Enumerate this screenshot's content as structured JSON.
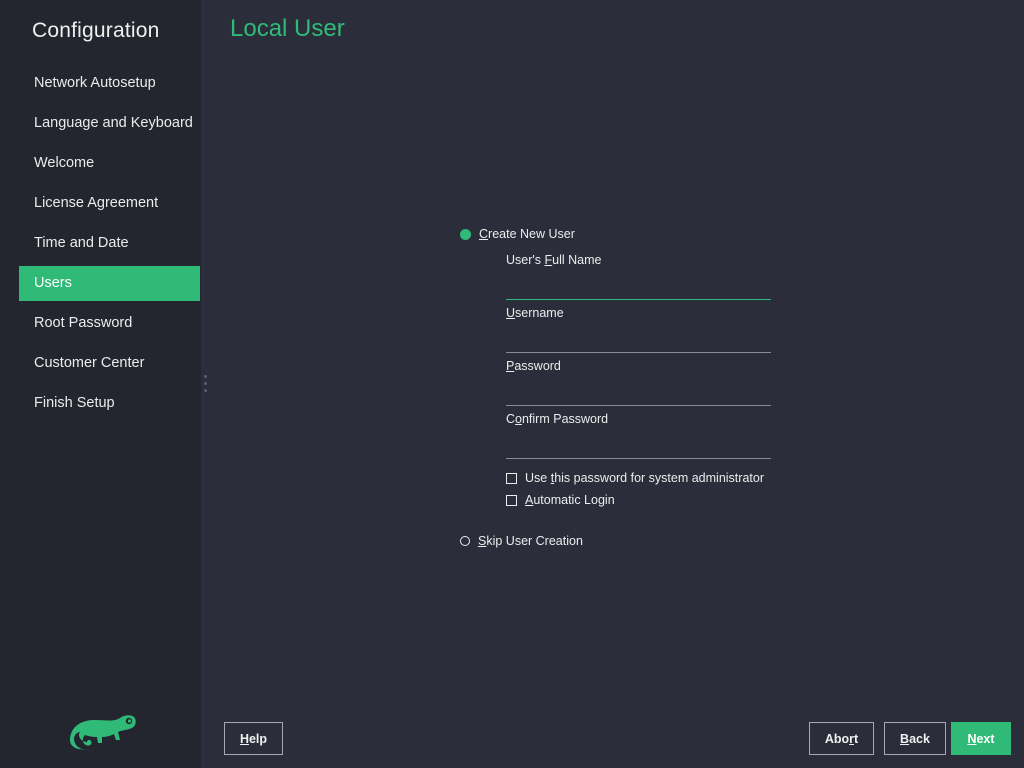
{
  "sidebar": {
    "title": "Configuration",
    "items": [
      {
        "label": "Network Autosetup"
      },
      {
        "label": "Language and Keyboard"
      },
      {
        "label": "Welcome"
      },
      {
        "label": "License Agreement"
      },
      {
        "label": "Time and Date"
      },
      {
        "label": "Users",
        "active": true
      },
      {
        "label": "Root Password"
      },
      {
        "label": "Customer Center"
      },
      {
        "label": "Finish Setup"
      }
    ]
  },
  "main": {
    "title": "Local User",
    "create_user": {
      "label_mnemonic": "C",
      "label_rest": "reate New User",
      "selected": true
    },
    "fields": {
      "full_name": {
        "pre": "User's ",
        "mnemonic": "F",
        "post": "ull Name",
        "value": ""
      },
      "username": {
        "pre": "",
        "mnemonic": "U",
        "post": "sername",
        "value": ""
      },
      "password": {
        "pre": "",
        "mnemonic": "P",
        "post": "assword",
        "value": ""
      },
      "confirm": {
        "pre": "C",
        "mnemonic": "o",
        "post": "nfirm Password",
        "value": ""
      }
    },
    "checkboxes": {
      "use_for_admin": {
        "pre": "Use ",
        "mnemonic": "t",
        "post": "his password for system administrator",
        "checked": false
      },
      "auto_login": {
        "pre": "",
        "mnemonic": "A",
        "post": "utomatic Login",
        "checked": false
      }
    },
    "skip_user": {
      "label_mnemonic": "S",
      "label_rest": "kip User Creation",
      "selected": false
    }
  },
  "buttons": {
    "help": {
      "mnemonic": "H",
      "rest": "elp"
    },
    "abort": {
      "pre": "Abo",
      "mnemonic": "r",
      "post": "t"
    },
    "back": {
      "mnemonic": "B",
      "rest": "ack"
    },
    "next": {
      "mnemonic": "N",
      "rest": "ext"
    }
  },
  "colors": {
    "accent": "#30ba78",
    "background": "#2b2e3a",
    "sidebar": "#23252f"
  }
}
